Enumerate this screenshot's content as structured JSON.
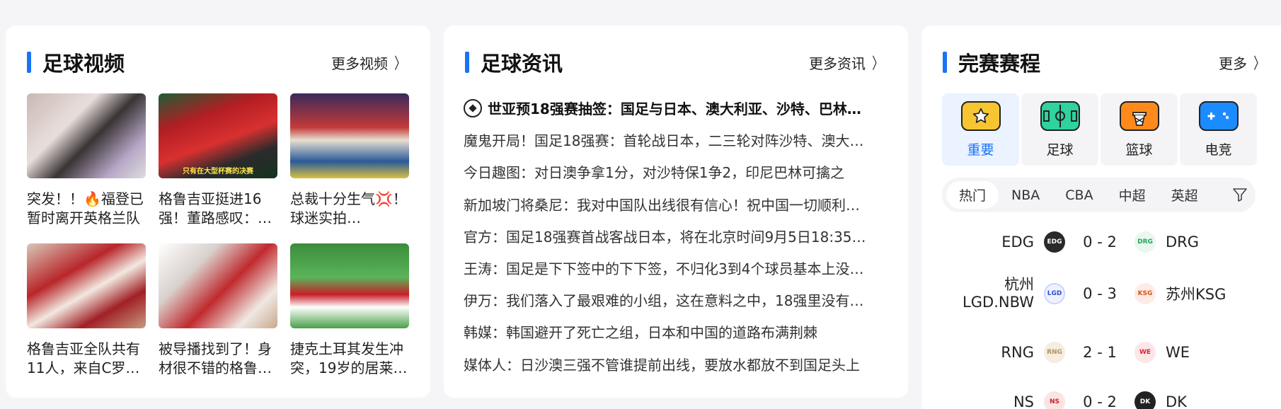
{
  "video": {
    "title": "足球视频",
    "more": "更多视频",
    "items": [
      {
        "caption": "突发！！🔥福登已暂时离开英格兰队"
      },
      {
        "caption": "格鲁吉亚挺进16强！董路感叹：…",
        "overlay": "只有在大型杯赛的决赛"
      },
      {
        "caption": "总裁十分生气💢！球迷实拍…"
      },
      {
        "caption": "格鲁吉亚全队共有11人，来自C罗…"
      },
      {
        "caption": "被导播找到了！身材很不错的格鲁…"
      },
      {
        "caption": "捷克土耳其发生冲突，19岁的居莱…"
      }
    ]
  },
  "news": {
    "title": "足球资讯",
    "more": "更多资讯",
    "items": [
      {
        "text": "世亚预18强赛抽签：国足与日本、澳大利亚、沙特、巴林…",
        "top": true
      },
      {
        "text": "魔鬼开局！国足18强赛：首轮战日本，二三轮对阵沙特、澳大…"
      },
      {
        "text": "今日趣图：对日澳争拿1分，对沙特保1争2，印尼巴林可擒之"
      },
      {
        "text": "新加坡门将桑尼：我对中国队出线很有信心！祝中国一切顺利…"
      },
      {
        "text": "官方：国足18强赛首战客战日本，将在北京时间9月5日18:35…"
      },
      {
        "text": "王涛：国足是下下签中的下下签，不归化3到4个球员基本上没…"
      },
      {
        "text": "伊万：我们落入了最艰难的小组，这在意料之中，18强里没有…"
      },
      {
        "text": "韩媒：韩国避开了死亡之组，日本和中国的道路布满荆棘"
      },
      {
        "text": "媒体人：日沙澳三强不管谁提前出线，要放水都放不到国足头上"
      }
    ]
  },
  "schedule": {
    "title": "完赛赛程",
    "more": "更多",
    "categories": [
      {
        "label": "重要",
        "icon": "star-icon",
        "color": "#f7c531"
      },
      {
        "label": "足球",
        "icon": "soccer-field-icon",
        "color": "#2ed3a0"
      },
      {
        "label": "篮球",
        "icon": "basketball-hoop-icon",
        "color": "#ff8a1c"
      },
      {
        "label": "电竞",
        "icon": "gamepad-icon",
        "color": "#1a8cff"
      }
    ],
    "tabs": [
      "热门",
      "NBA",
      "CBA",
      "中超",
      "英超"
    ],
    "matches": [
      {
        "home": "EDG",
        "score": "0 - 2",
        "away": "DRG",
        "home_logo": "EDG",
        "away_logo": "DRG"
      },
      {
        "home": "杭州LGD.NBW",
        "score": "0 - 3",
        "away": "苏州KSG",
        "home_logo": "LGD",
        "away_logo": "KSG"
      },
      {
        "home": "RNG",
        "score": "2 - 1",
        "away": "WE",
        "home_logo": "RNG",
        "away_logo": "WE"
      },
      {
        "home": "NS",
        "score": "0 - 2",
        "away": "DK",
        "home_logo": "NS",
        "away_logo": "DK"
      }
    ]
  }
}
